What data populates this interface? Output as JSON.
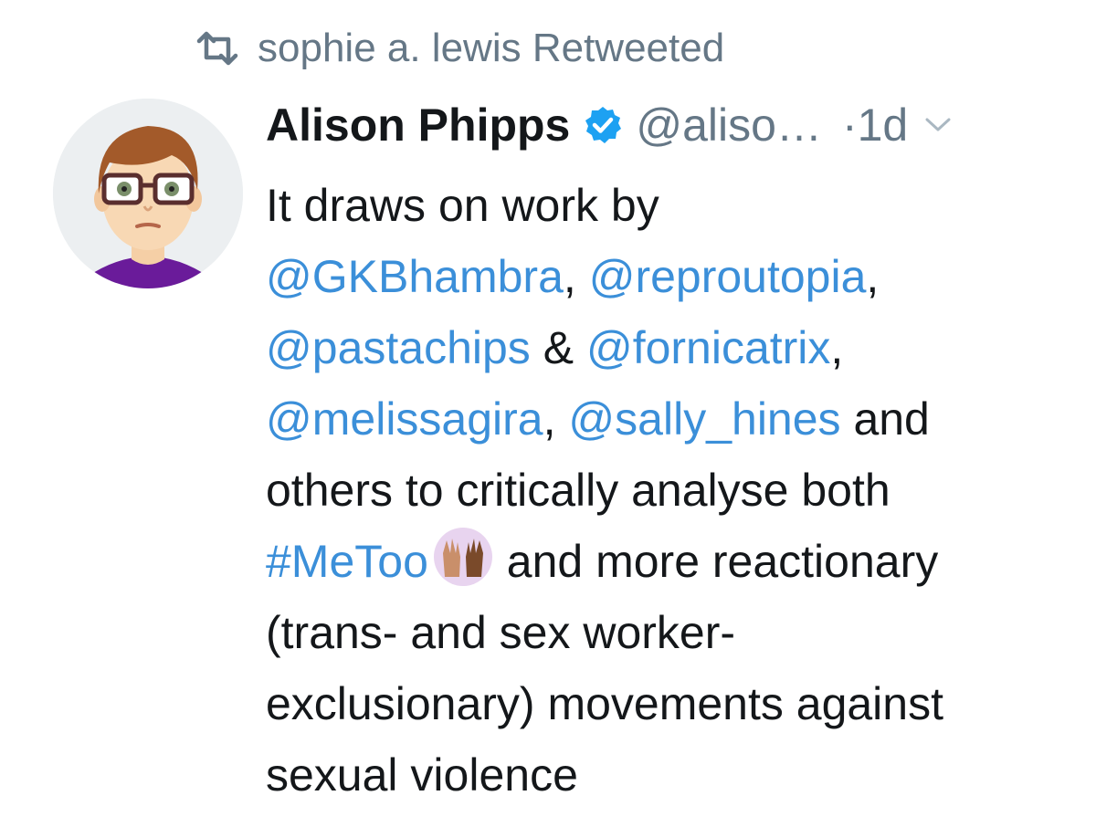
{
  "retweet": {
    "icon": "retweet-icon",
    "text": "sophie a. lewis Retweeted"
  },
  "tweet": {
    "author": {
      "avatar_icon": "cartoon-avatar-woman-glasses",
      "name": "Alison Phipps",
      "verified_icon": "verified-badge-icon",
      "handle": "@aliso…"
    },
    "separator": "·",
    "time": "1d",
    "menu_icon": "chevron-down-icon",
    "lines": [
      {
        "parts": [
          {
            "text": "It draws on work by"
          }
        ]
      },
      {
        "parts": [
          {
            "text": "@GKBhambra",
            "kind": "mention"
          },
          {
            "text": ", "
          },
          {
            "text": "@reproutopia",
            "kind": "mention"
          },
          {
            "text": ","
          }
        ]
      },
      {
        "parts": [
          {
            "text": "@pastachips",
            "kind": "mention"
          },
          {
            "text": " & "
          },
          {
            "text": "@fornicatrix",
            "kind": "mention"
          },
          {
            "text": ","
          }
        ]
      },
      {
        "parts": [
          {
            "text": "@melissagira",
            "kind": "mention"
          },
          {
            "text": ", "
          },
          {
            "text": "@sally_hines",
            "kind": "mention"
          },
          {
            "text": " and"
          }
        ]
      },
      {
        "parts": [
          {
            "text": "others to critically analyse both"
          }
        ]
      },
      {
        "parts": [
          {
            "text": "#MeToo",
            "kind": "hashtag"
          },
          {
            "kind": "emoji",
            "icon": "raised-hands-emoji"
          },
          {
            "text": " and more reactionary"
          }
        ]
      },
      {
        "parts": [
          {
            "text": "(trans- and sex worker-"
          }
        ]
      },
      {
        "parts": [
          {
            "text": "exclusionary) movements against"
          }
        ]
      },
      {
        "parts": [
          {
            "text": "sexual violence"
          }
        ]
      }
    ]
  },
  "colors": {
    "link": "#3b8fd9",
    "muted": "#657786",
    "text": "#14171a",
    "verified": "#1da1f2"
  }
}
